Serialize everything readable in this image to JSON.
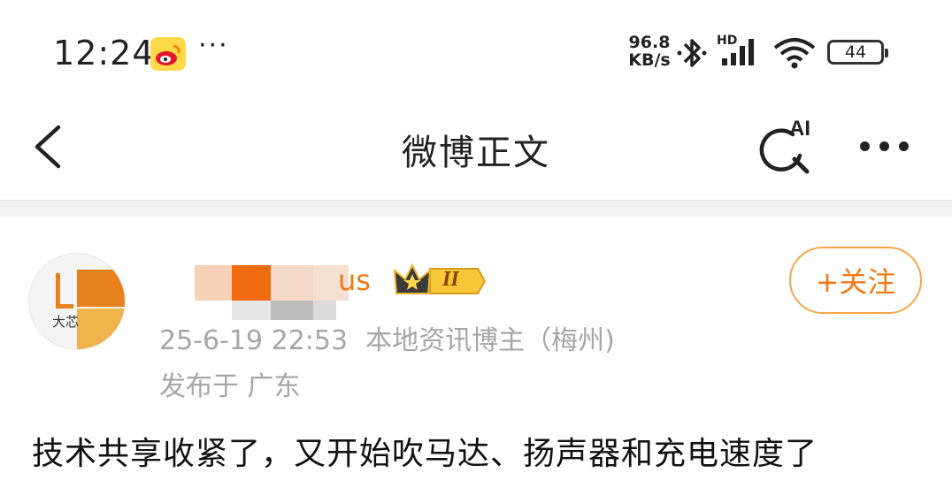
{
  "status_bar": {
    "time": "12:24",
    "app_icon": "weibo-icon",
    "more_notifications": "···",
    "net_speed_value": "96.8",
    "net_speed_unit": "KB/s",
    "signal_label": "HD",
    "battery_percent": 44,
    "battery_text": "44",
    "icons": [
      "bluetooth-icon",
      "signal-icon",
      "wifi-icon",
      "battery-icon"
    ]
  },
  "nav": {
    "title": "微博正文",
    "ai_label": "AI",
    "icons": [
      "back-icon",
      "ai-search-icon",
      "more-icon"
    ]
  },
  "post": {
    "author_suffix": "us",
    "badge_level": "II",
    "follow_label": "+关注",
    "date": "25-6-19 22:53",
    "author_title": "本地资讯博主（梅州)",
    "location": "发布于 广东",
    "avatar_text": "大芯",
    "body": "技术共享收紧了，又开始吹马达、扬声器和充电速度了"
  },
  "colors": {
    "accent": "#f07a16",
    "follow_border": "#f4a74a",
    "meta_gray": "#a6a6a6",
    "divider": "#f2f2f2"
  }
}
